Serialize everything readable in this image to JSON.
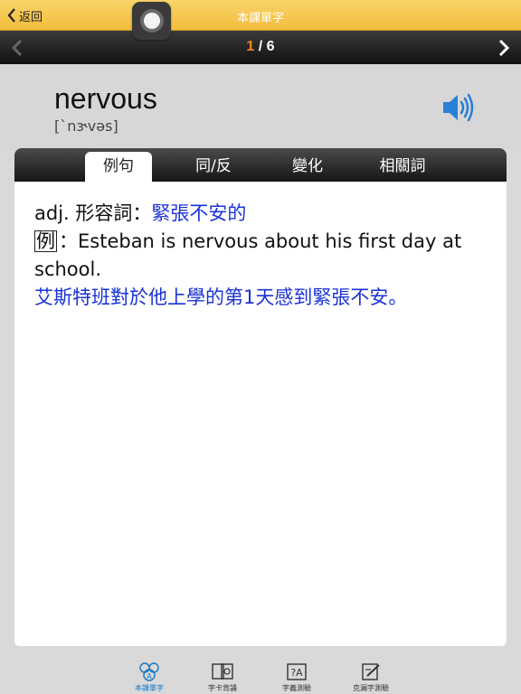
{
  "topbar": {
    "back_label": "返回",
    "title": "本課單字"
  },
  "pager": {
    "current": "1",
    "separator": " / ",
    "total": "6"
  },
  "word": {
    "text": "nervous",
    "phonetic": "[ˋnɝvəs]"
  },
  "tabs": [
    {
      "label": "例句",
      "active": true
    },
    {
      "label": "同/反",
      "active": false
    },
    {
      "label": "變化",
      "active": false
    },
    {
      "label": "相關詞",
      "active": false
    }
  ],
  "content": {
    "pos": "adj. 形容詞：",
    "definition": "緊張不安的",
    "example_marker": "例",
    "example_sep": "：",
    "example_en": "Esteban is nervous about his first day at school.",
    "example_zh": "艾斯特班對於他上學的第1天感到緊張不安。"
  },
  "bottom_tabs": [
    {
      "label": "本課單字",
      "icon": "abc-word-icon",
      "active": true
    },
    {
      "label": "字卡背誦",
      "icon": "flashcard-icon",
      "active": false
    },
    {
      "label": "字義測驗",
      "icon": "quiz-icon",
      "active": false
    },
    {
      "label": "克漏字測驗",
      "icon": "cloze-test-icon",
      "active": false
    }
  ],
  "colors": {
    "topbar": "#f2bd3c",
    "pager_current": "#f08a1c",
    "definition_blue": "#1a33d6",
    "active_tab_blue": "#1478c8"
  }
}
